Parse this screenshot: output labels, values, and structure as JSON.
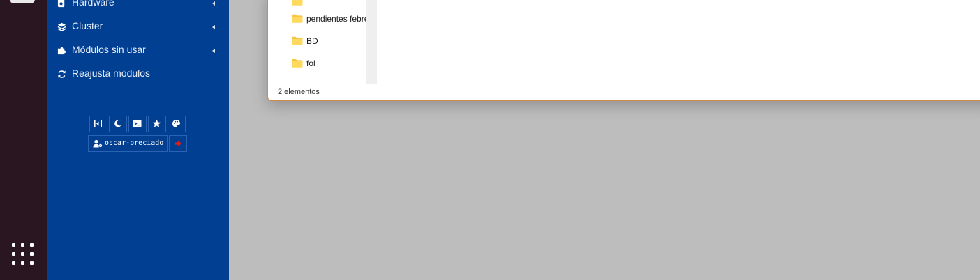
{
  "sidebar": {
    "items": [
      {
        "label": "Hardware",
        "icon": "hardware-icon"
      },
      {
        "label": "Cluster",
        "icon": "layers-icon"
      },
      {
        "label": "Módulos sin usar",
        "icon": "puzzle-icon"
      },
      {
        "label": "Reajusta módulos",
        "icon": "refresh-icon"
      }
    ],
    "toolbar": [
      "collapse-icon",
      "moon-icon",
      "terminal-icon",
      "star-icon",
      "palette-icon"
    ],
    "username": "oscar-preciado",
    "colors": {
      "background": "#003f92",
      "logout_accent": "#e0201b"
    }
  },
  "dock": {
    "app_grid_icon": "app-grid-icon"
  },
  "file_manager": {
    "folders": [
      {
        "name": "pendientes febre"
      },
      {
        "name": "BD"
      },
      {
        "name": "fol"
      }
    ],
    "status": "2 elementos",
    "colors": {
      "folder": "#f6c544",
      "border": "#d38a4a"
    }
  }
}
